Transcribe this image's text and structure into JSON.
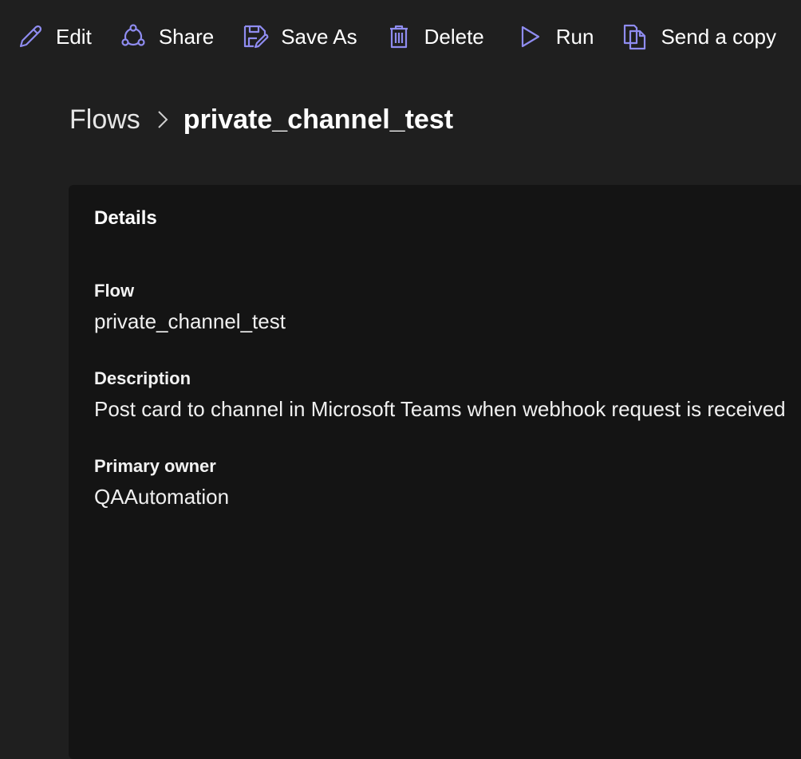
{
  "toolbar": {
    "edit_label": "Edit",
    "share_label": "Share",
    "save_as_label": "Save As",
    "delete_label": "Delete",
    "run_label": "Run",
    "send_copy_label": "Send a copy",
    "icon_color": "#8f8cf0"
  },
  "breadcrumb": {
    "root": "Flows",
    "current": "private_channel_test"
  },
  "details": {
    "title": "Details",
    "flow_label": "Flow",
    "flow_value": "private_channel_test",
    "description_label": "Description",
    "description_value": "Post card to channel in Microsoft Teams when webhook request is received",
    "owner_label": "Primary owner",
    "owner_value": "QAAutomation"
  }
}
